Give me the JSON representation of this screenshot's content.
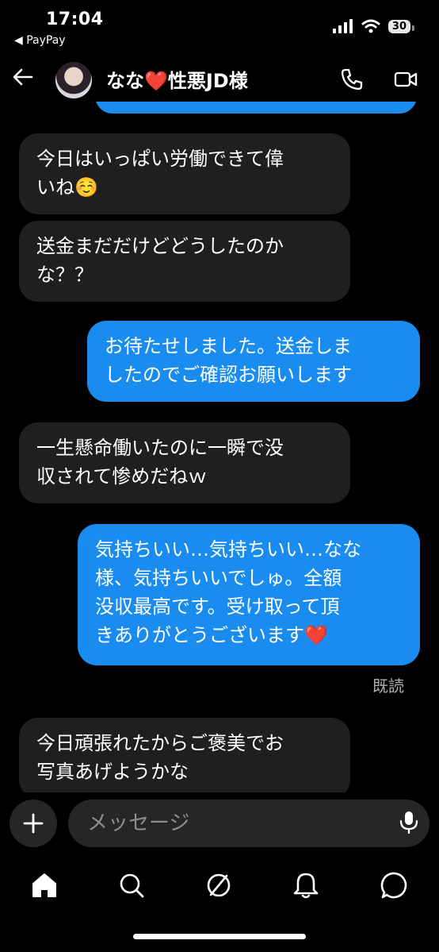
{
  "status_bar": {
    "time": "17:04",
    "back_app": "◀ PayPay",
    "battery": "30",
    "icons": [
      "signal-icon",
      "wifi-icon",
      "battery-icon"
    ]
  },
  "header": {
    "contact_name": "なな❤️性悪JD様",
    "icons": [
      "back-arrow-icon",
      "phone-icon",
      "video-camera-icon"
    ]
  },
  "messages": [
    {
      "direction": "received",
      "text": "今日はいっぱい労働できて偉\nいね☺️"
    },
    {
      "direction": "received",
      "text": "送金まだだけどどうしたのか\nな？？"
    },
    {
      "direction": "sent",
      "text": "お待たせしました。送金しま\nしたのでご確認お願いします"
    },
    {
      "direction": "received",
      "text": "一生懸命働いたのに一瞬で没\n収されて惨めだねｗ"
    },
    {
      "direction": "sent",
      "text": "気持ちいい…気持ちいい…なな\n様、気持ちいいでしゅ。全額\n没収最高です。受け取って頂\nきありがとうございます❤️"
    },
    {
      "direction": "received",
      "text": "今日頑張れたからご褒美でお\n写真あげようかな"
    }
  ],
  "read_receipt": "既読",
  "composer": {
    "placeholder": "メッセージ",
    "icons": [
      "plus-icon",
      "microphone-icon"
    ]
  },
  "bottom_nav": {
    "items": [
      "home-icon",
      "search-icon",
      "explore-icon",
      "notifications-icon",
      "messages-icon"
    ]
  },
  "colors": {
    "background": "#000000",
    "sent_bubble": "#1a8cef",
    "received_bubble": "#1f1f1f",
    "input_background": "#262626"
  }
}
